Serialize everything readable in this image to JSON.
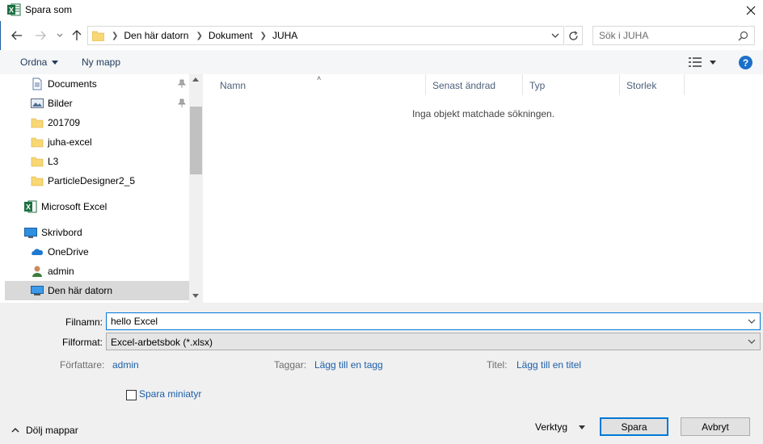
{
  "window": {
    "title": "Spara som"
  },
  "address": {
    "crumbs": [
      "Den här datorn",
      "Dokument",
      "JUHA"
    ],
    "search_placeholder": "Sök i JUHA"
  },
  "toolbar": {
    "organize": "Ordna",
    "new_folder": "Ny mapp",
    "help": "?"
  },
  "nav": {
    "items": [
      {
        "label": "Documents",
        "icon": "documents-icon",
        "pinned": true
      },
      {
        "label": "Bilder",
        "icon": "pictures-icon",
        "pinned": true
      },
      {
        "label": "201709",
        "icon": "folder-icon"
      },
      {
        "label": "juha-excel",
        "icon": "folder-icon"
      },
      {
        "label": "L3",
        "icon": "folder-icon"
      },
      {
        "label": "ParticleDesigner2_5",
        "icon": "folder-icon"
      },
      {
        "label": "Microsoft Excel",
        "icon": "excel-icon"
      },
      {
        "label": "Skrivbord",
        "icon": "desktop-icon"
      },
      {
        "label": "OneDrive",
        "icon": "onedrive-icon"
      },
      {
        "label": "admin",
        "icon": "user-icon"
      },
      {
        "label": "Den här datorn",
        "icon": "computer-icon",
        "selected": true
      }
    ]
  },
  "files": {
    "columns": [
      "Namn",
      "Senast ändrad",
      "Typ",
      "Storlek"
    ],
    "empty_message": "Inga objekt matchade sökningen."
  },
  "form": {
    "filename_label": "Filnamn:",
    "filename_value": "hello Excel",
    "format_label": "Filformat:",
    "format_value": "Excel-arbetsbok (*.xlsx)",
    "author_label": "Författare:",
    "author_value": "admin",
    "tags_label": "Taggar:",
    "tags_value": "Lägg till en tagg",
    "title_label": "Titel:",
    "title_value": "Lägg till en titel",
    "thumbnail_label": "Spara miniatyr"
  },
  "footer": {
    "hide_folders": "Dölj mappar",
    "tools": "Verktyg",
    "save": "Spara",
    "cancel": "Avbryt"
  },
  "colors": {
    "accent": "#0078d7",
    "link": "#1c5fa8",
    "selection": "#d9d9d9",
    "excel_green": "#1d6f42"
  }
}
